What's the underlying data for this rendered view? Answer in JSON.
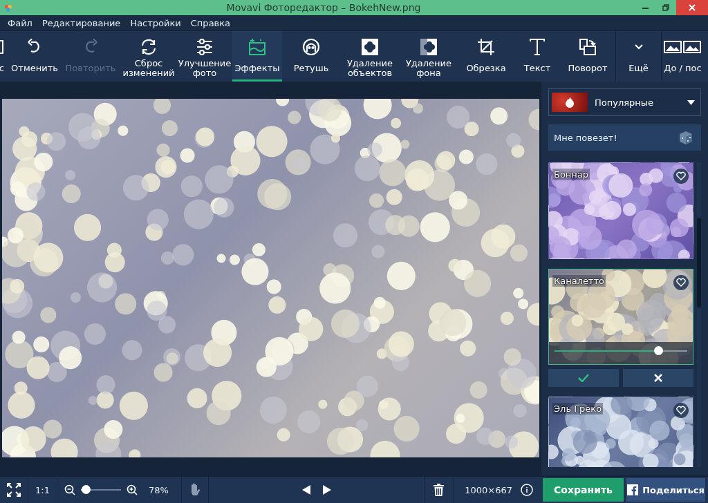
{
  "window": {
    "title": "Movavi Фоторедактор – BokehNew.png"
  },
  "menu": [
    "Файл",
    "Редактирование",
    "Настройки",
    "Справка"
  ],
  "toolbar": [
    {
      "label": "с",
      "kind": "cut",
      "disabled": false,
      "selected": false
    },
    {
      "label": "Отменить",
      "kind": "undo",
      "disabled": false,
      "selected": false
    },
    {
      "label": "Повторить",
      "kind": "redo",
      "disabled": true,
      "selected": false
    },
    {
      "label": "Сброс изменений",
      "kind": "reset",
      "disabled": false,
      "selected": false
    },
    {
      "label": "Улучшение фото",
      "kind": "adjust",
      "disabled": false,
      "selected": false
    },
    {
      "label": "Эффекты",
      "kind": "effects",
      "disabled": false,
      "selected": true
    },
    {
      "label": "Ретушь",
      "kind": "retouch",
      "disabled": false,
      "selected": false
    },
    {
      "label": "Удаление объектов",
      "kind": "objects",
      "disabled": false,
      "selected": false
    },
    {
      "label": "Удаление фона",
      "kind": "background",
      "disabled": false,
      "selected": false
    },
    {
      "label": "Обрезка",
      "kind": "crop",
      "disabled": false,
      "selected": false
    },
    {
      "label": "Текст",
      "kind": "text",
      "disabled": false,
      "selected": false
    },
    {
      "label": "Поворот",
      "kind": "rotate",
      "disabled": false,
      "selected": false
    },
    {
      "label": "Ещё",
      "kind": "more",
      "disabled": false,
      "selected": false
    },
    {
      "label": "До / пос",
      "kind": "compare",
      "disabled": false,
      "selected": false
    }
  ],
  "effects_panel": {
    "category": "Популярные",
    "lucky_button": "Мне повезет!",
    "effects": [
      {
        "name": "Боннар",
        "selected": false
      },
      {
        "name": "Каналетто",
        "selected": true,
        "level": 0.78
      },
      {
        "name": "Эль Греко",
        "selected": false
      }
    ]
  },
  "bottom_bar": {
    "actual_size": "1:1",
    "zoom_slider": {
      "level": 0.12
    },
    "zoom": "78%",
    "dimensions": "1000×667",
    "save": "Сохранить",
    "share": "Поделиться"
  }
}
